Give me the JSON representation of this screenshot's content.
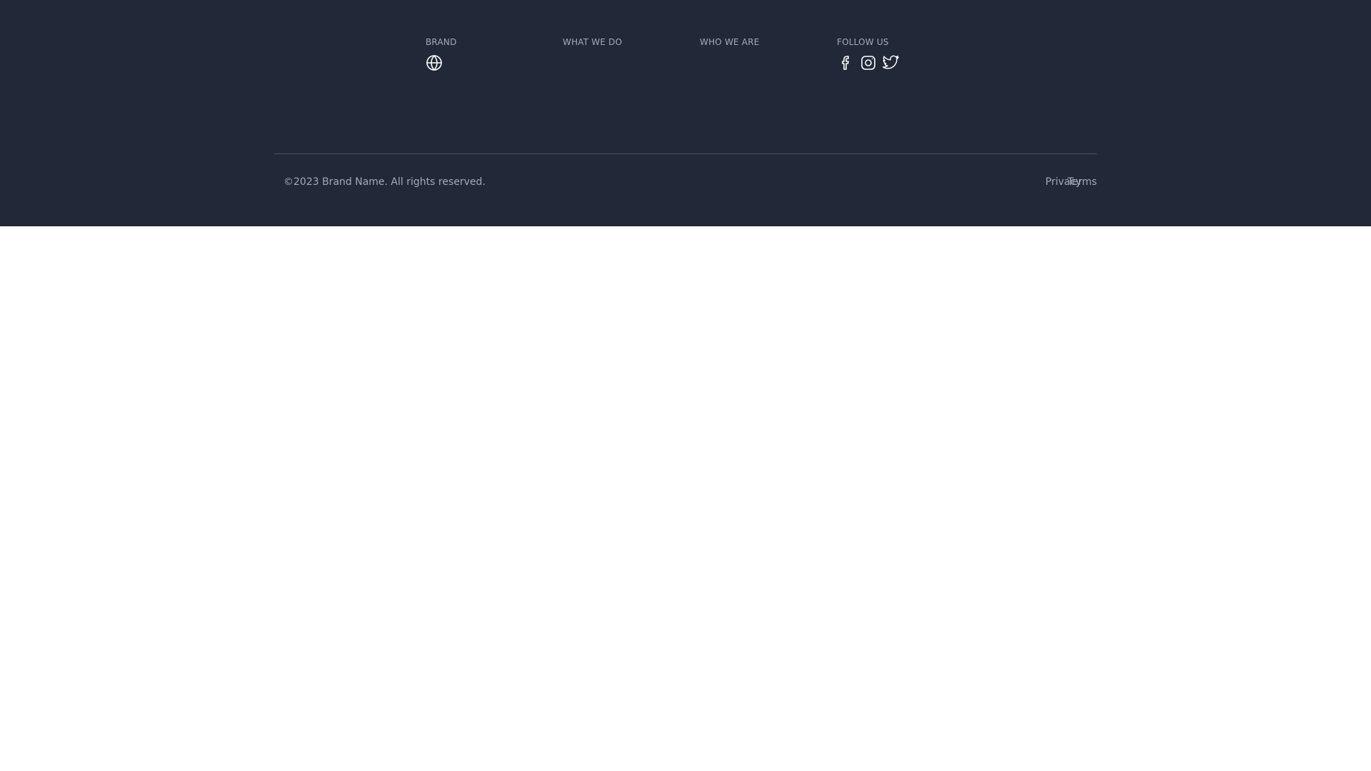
{
  "footer": {
    "background_color": "#212938",
    "text_color": "#a3aab6",
    "columns": [
      {
        "heading": "BRAND"
      },
      {
        "heading": "WHAT WE DO"
      },
      {
        "heading": "WHO WE ARE"
      },
      {
        "heading": "FOLLOW US"
      }
    ],
    "brand_icon": "globe-icon",
    "social_icons": [
      "facebook-icon",
      "instagram-icon",
      "twitter-icon"
    ],
    "copyright": "©2023 Brand Name. All rights reserved.",
    "links": [
      {
        "label": "Privacy"
      },
      {
        "label": "Terms"
      }
    ]
  }
}
